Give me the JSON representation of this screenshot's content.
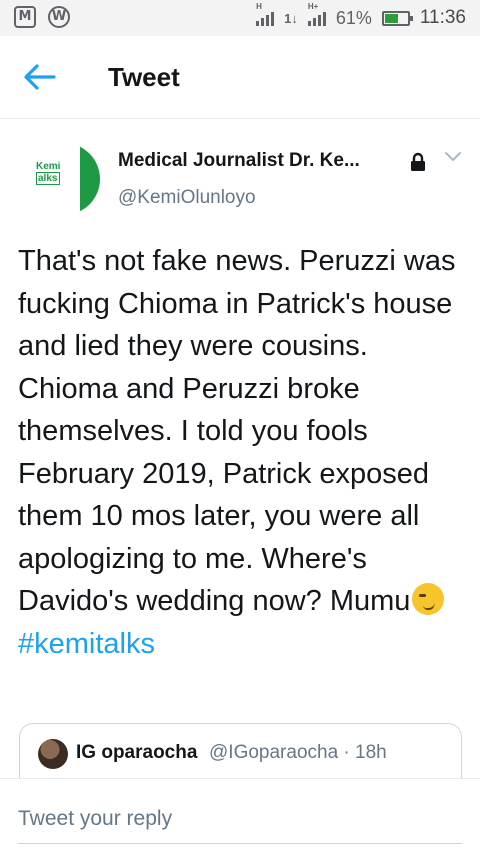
{
  "status_bar": {
    "left_icons": [
      "gmail-icon",
      "wordpress-icon"
    ],
    "gmail_glyph": "M",
    "wordpress_glyph": "W",
    "signal_1_label": "H",
    "signal_2_label": "H+",
    "data_arrows": "1↓",
    "battery_percent": "61%",
    "battery_level": 0.61,
    "time": "11:36"
  },
  "header": {
    "title": "Tweet",
    "back_icon": "arrow-left-icon"
  },
  "tweet": {
    "avatar_text_line1": "Kemi",
    "avatar_text_line2": "alks",
    "author_name": "Medical Journalist Dr. Ke...",
    "author_handle": "@KemiOlunloyo",
    "protected": "lock-icon",
    "text": "That's not fake news. Peruzzi was fucking Chioma in Patrick's house and lied they were cousins. Chioma and Peruzzi broke themselves. I told you fools February 2019, Patrick exposed them 10 mos later, you were all apologizing to me. Where's Davido's wedding now? Mumu",
    "emoji": "smirk-emoji",
    "hashtag": "#kemitalks"
  },
  "quoted_tweet": {
    "name": "IG oparaocha",
    "meta": "@IGoparaocha · 18h"
  },
  "reply": {
    "placeholder": "Tweet your reply"
  },
  "colors": {
    "accent": "#1da1f2",
    "text": "#14171a",
    "secondary": "#657786",
    "avatar_green": "#1e9a45"
  }
}
